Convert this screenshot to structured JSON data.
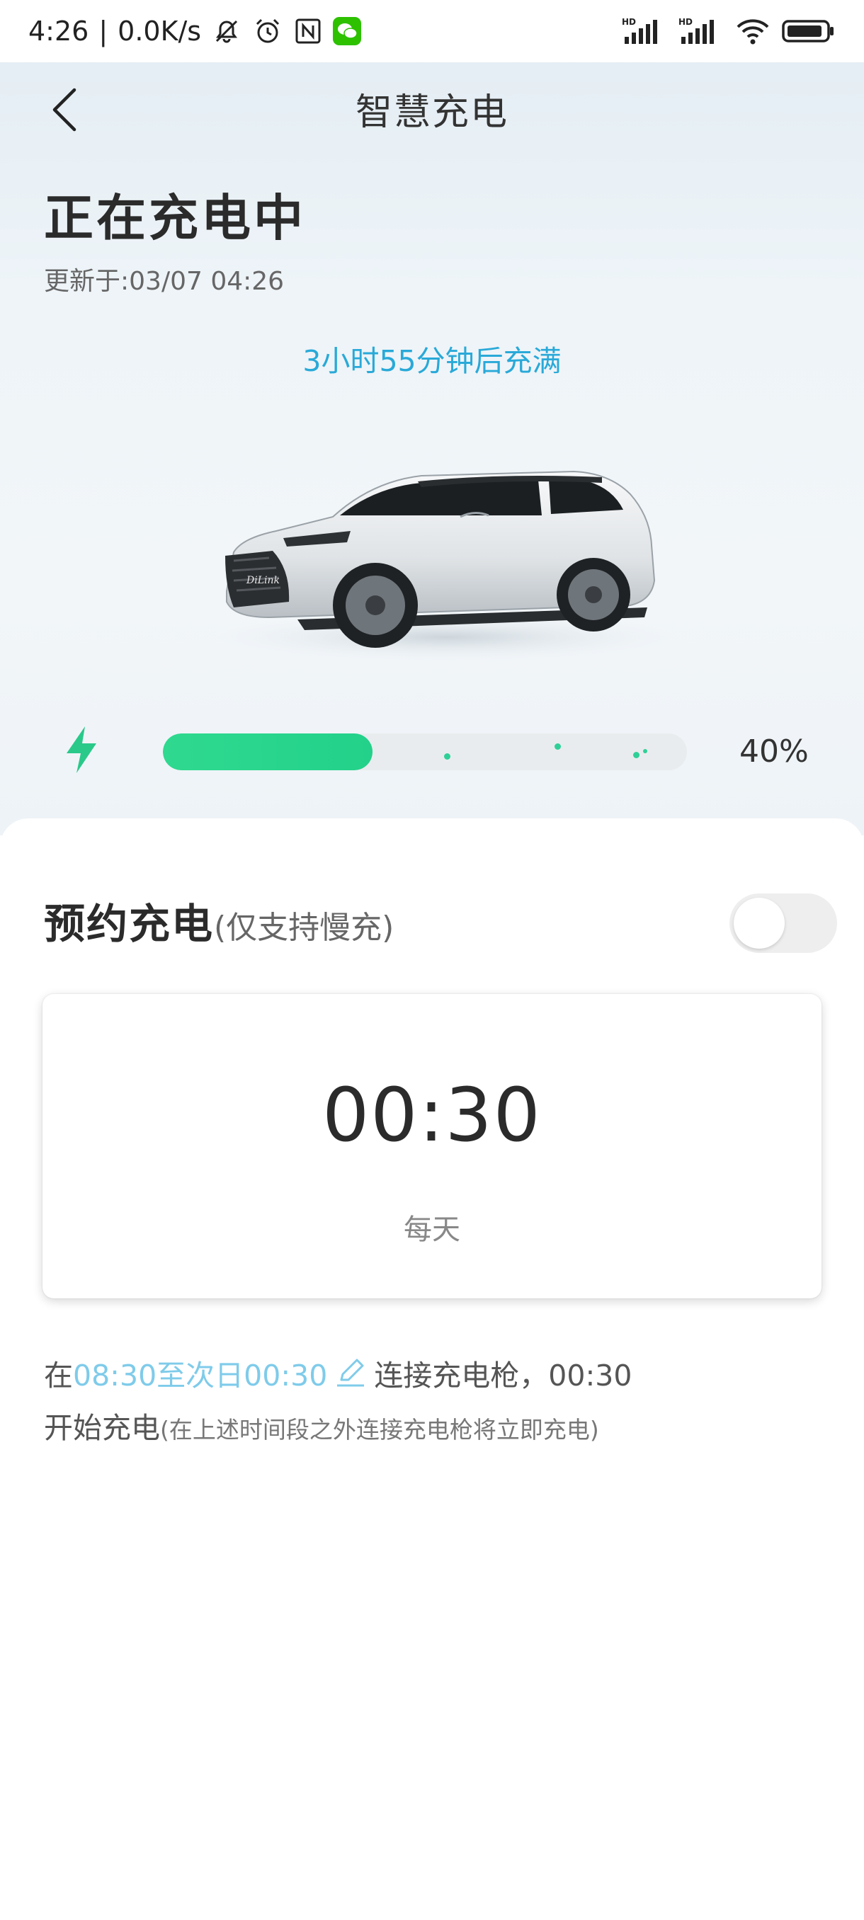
{
  "status_bar": {
    "time": "4:26",
    "separator": "|",
    "net_speed": "0.0K/s",
    "icons": [
      "mute-bell-icon",
      "alarm-icon",
      "nfc-icon",
      "wechat-icon",
      "hd-signal-icon",
      "hd-signal-icon",
      "wifi-icon",
      "battery-icon"
    ],
    "hd_label": "HD"
  },
  "header": {
    "title": "智慧充电",
    "back_icon": "chevron-left-icon"
  },
  "charging": {
    "status": "正在充电中",
    "update_time": "更新于:03/07 04:26",
    "remaining": "3小时55分钟后充满",
    "percent_text": "40%",
    "progress_fraction": 0.4,
    "accent_color": "#2fd98f",
    "car_badge": "DiLink"
  },
  "schedule": {
    "title": "预约充电",
    "note": "(仅支持慢充)",
    "enabled": false,
    "time": "00:30",
    "repeat": "每天"
  },
  "description": {
    "prefix": "在",
    "window": "08:30至次日00:30",
    "middle": "连接充电枪，00:30",
    "line2": "开始充电",
    "note": "(在上述时间段之外连接充电枪将立即充电)",
    "highlight_color": "#7fcbea"
  }
}
